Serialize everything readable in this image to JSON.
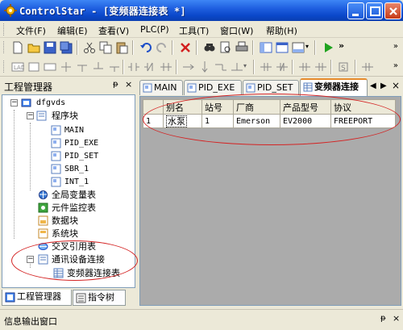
{
  "window": {
    "title": "ControlStar - [变频器连接表 *]",
    "minimize_icon": "minimize-icon",
    "maximize_icon": "maximize-icon",
    "close_icon": "close-icon"
  },
  "menu": {
    "items": [
      "文件(F)",
      "编辑(E)",
      "查看(V)",
      "PLC(P)",
      "工具(T)",
      "窗口(W)",
      "帮助(H)"
    ]
  },
  "toolbar": {
    "overflow": "»"
  },
  "left_panel": {
    "title": "工程管理器",
    "pin": "ᵽ",
    "close": "×",
    "tree": {
      "project": "dfgvds",
      "program_blocks": "程序块",
      "blocks": [
        "MAIN",
        "PID_EXE",
        "PID_SET",
        "SBR_1",
        "INT_1"
      ],
      "global_vars": "全局变量表",
      "monitor": "元件监控表",
      "data_block": "数据块",
      "system_block": "系统块",
      "cross_ref": "交叉引用表",
      "comm": "通讯设备连接",
      "vfd_table": "变频器连接表"
    },
    "tabs": [
      "工程管理器",
      "指令树"
    ]
  },
  "doc_tabs": {
    "tabs": [
      "MAIN",
      "PID_EXE",
      "PID_SET",
      "变频器连接"
    ],
    "nav_left": "◀",
    "nav_right": "▶",
    "close": "×"
  },
  "grid": {
    "headers": [
      "",
      "别名",
      "站号",
      "厂商",
      "产品型号",
      "协议"
    ],
    "rows": [
      [
        "1",
        "水泵",
        "1",
        "Emerson",
        "EV2000",
        "FREEPORT"
      ]
    ]
  },
  "info_panel": {
    "title": "信息输出窗口",
    "pin": "ᵽ",
    "close": "×"
  },
  "colors": {
    "titlebar": "#0a47c9",
    "annotation": "#d42424",
    "active_tab_accent": "#e68b2c"
  }
}
